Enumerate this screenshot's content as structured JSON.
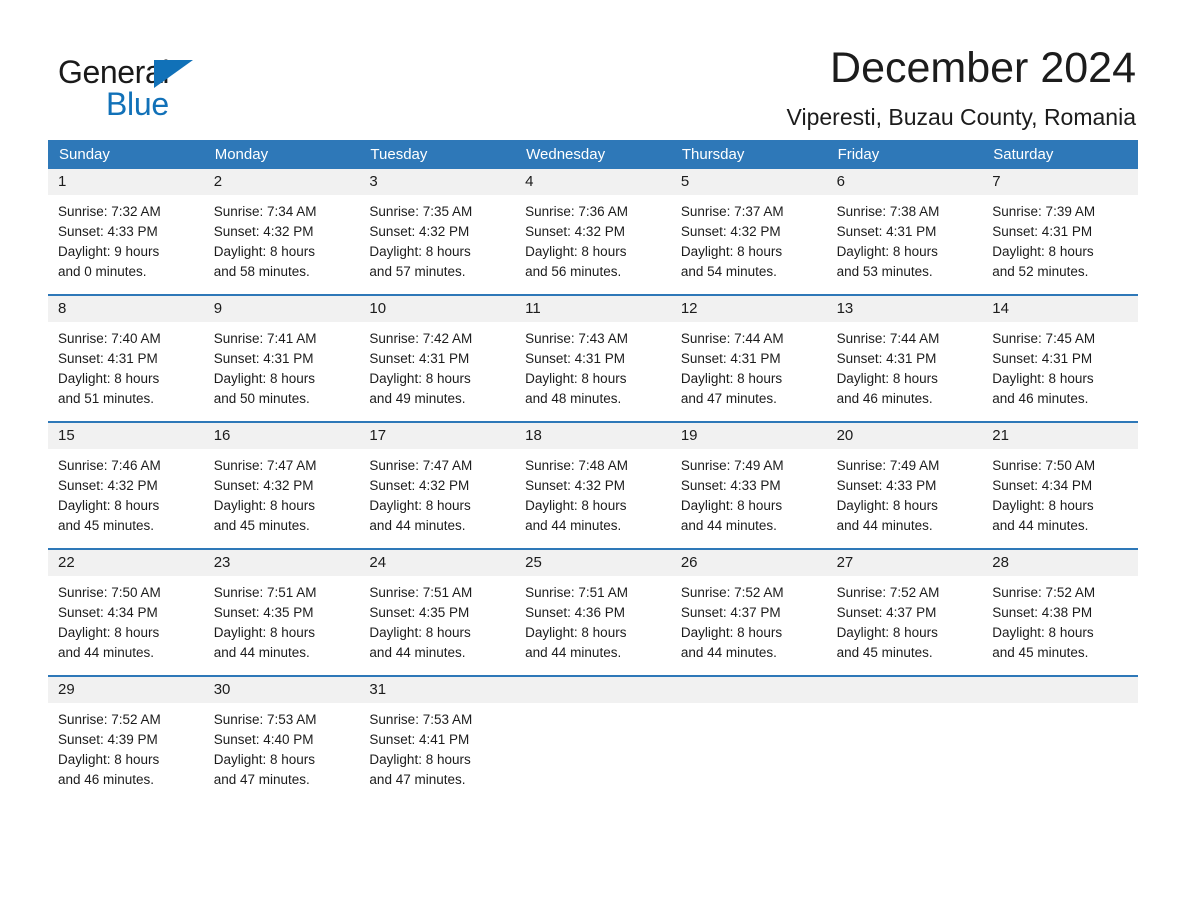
{
  "brand": {
    "name_part1": "General",
    "name_part2": "Blue",
    "accent_color": "#1171b8",
    "triangle_icon": "triangle-icon"
  },
  "header": {
    "month_title": "December 2024",
    "location": "Viperesti, Buzau County, Romania"
  },
  "calendar": {
    "header_bg": "#2e78b8",
    "row_rule_color": "#2e78b8",
    "date_strip_bg": "#f1f1f1",
    "weekdays": [
      "Sunday",
      "Monday",
      "Tuesday",
      "Wednesday",
      "Thursday",
      "Friday",
      "Saturday"
    ],
    "weeks": [
      [
        {
          "date": "1",
          "sunrise": "Sunrise: 7:32 AM",
          "sunset": "Sunset: 4:33 PM",
          "daylight_line1": "Daylight: 9 hours",
          "daylight_line2": "and 0 minutes."
        },
        {
          "date": "2",
          "sunrise": "Sunrise: 7:34 AM",
          "sunset": "Sunset: 4:32 PM",
          "daylight_line1": "Daylight: 8 hours",
          "daylight_line2": "and 58 minutes."
        },
        {
          "date": "3",
          "sunrise": "Sunrise: 7:35 AM",
          "sunset": "Sunset: 4:32 PM",
          "daylight_line1": "Daylight: 8 hours",
          "daylight_line2": "and 57 minutes."
        },
        {
          "date": "4",
          "sunrise": "Sunrise: 7:36 AM",
          "sunset": "Sunset: 4:32 PM",
          "daylight_line1": "Daylight: 8 hours",
          "daylight_line2": "and 56 minutes."
        },
        {
          "date": "5",
          "sunrise": "Sunrise: 7:37 AM",
          "sunset": "Sunset: 4:32 PM",
          "daylight_line1": "Daylight: 8 hours",
          "daylight_line2": "and 54 minutes."
        },
        {
          "date": "6",
          "sunrise": "Sunrise: 7:38 AM",
          "sunset": "Sunset: 4:31 PM",
          "daylight_line1": "Daylight: 8 hours",
          "daylight_line2": "and 53 minutes."
        },
        {
          "date": "7",
          "sunrise": "Sunrise: 7:39 AM",
          "sunset": "Sunset: 4:31 PM",
          "daylight_line1": "Daylight: 8 hours",
          "daylight_line2": "and 52 minutes."
        }
      ],
      [
        {
          "date": "8",
          "sunrise": "Sunrise: 7:40 AM",
          "sunset": "Sunset: 4:31 PM",
          "daylight_line1": "Daylight: 8 hours",
          "daylight_line2": "and 51 minutes."
        },
        {
          "date": "9",
          "sunrise": "Sunrise: 7:41 AM",
          "sunset": "Sunset: 4:31 PM",
          "daylight_line1": "Daylight: 8 hours",
          "daylight_line2": "and 50 minutes."
        },
        {
          "date": "10",
          "sunrise": "Sunrise: 7:42 AM",
          "sunset": "Sunset: 4:31 PM",
          "daylight_line1": "Daylight: 8 hours",
          "daylight_line2": "and 49 minutes."
        },
        {
          "date": "11",
          "sunrise": "Sunrise: 7:43 AM",
          "sunset": "Sunset: 4:31 PM",
          "daylight_line1": "Daylight: 8 hours",
          "daylight_line2": "and 48 minutes."
        },
        {
          "date": "12",
          "sunrise": "Sunrise: 7:44 AM",
          "sunset": "Sunset: 4:31 PM",
          "daylight_line1": "Daylight: 8 hours",
          "daylight_line2": "and 47 minutes."
        },
        {
          "date": "13",
          "sunrise": "Sunrise: 7:44 AM",
          "sunset": "Sunset: 4:31 PM",
          "daylight_line1": "Daylight: 8 hours",
          "daylight_line2": "and 46 minutes."
        },
        {
          "date": "14",
          "sunrise": "Sunrise: 7:45 AM",
          "sunset": "Sunset: 4:31 PM",
          "daylight_line1": "Daylight: 8 hours",
          "daylight_line2": "and 46 minutes."
        }
      ],
      [
        {
          "date": "15",
          "sunrise": "Sunrise: 7:46 AM",
          "sunset": "Sunset: 4:32 PM",
          "daylight_line1": "Daylight: 8 hours",
          "daylight_line2": "and 45 minutes."
        },
        {
          "date": "16",
          "sunrise": "Sunrise: 7:47 AM",
          "sunset": "Sunset: 4:32 PM",
          "daylight_line1": "Daylight: 8 hours",
          "daylight_line2": "and 45 minutes."
        },
        {
          "date": "17",
          "sunrise": "Sunrise: 7:47 AM",
          "sunset": "Sunset: 4:32 PM",
          "daylight_line1": "Daylight: 8 hours",
          "daylight_line2": "and 44 minutes."
        },
        {
          "date": "18",
          "sunrise": "Sunrise: 7:48 AM",
          "sunset": "Sunset: 4:32 PM",
          "daylight_line1": "Daylight: 8 hours",
          "daylight_line2": "and 44 minutes."
        },
        {
          "date": "19",
          "sunrise": "Sunrise: 7:49 AM",
          "sunset": "Sunset: 4:33 PM",
          "daylight_line1": "Daylight: 8 hours",
          "daylight_line2": "and 44 minutes."
        },
        {
          "date": "20",
          "sunrise": "Sunrise: 7:49 AM",
          "sunset": "Sunset: 4:33 PM",
          "daylight_line1": "Daylight: 8 hours",
          "daylight_line2": "and 44 minutes."
        },
        {
          "date": "21",
          "sunrise": "Sunrise: 7:50 AM",
          "sunset": "Sunset: 4:34 PM",
          "daylight_line1": "Daylight: 8 hours",
          "daylight_line2": "and 44 minutes."
        }
      ],
      [
        {
          "date": "22",
          "sunrise": "Sunrise: 7:50 AM",
          "sunset": "Sunset: 4:34 PM",
          "daylight_line1": "Daylight: 8 hours",
          "daylight_line2": "and 44 minutes."
        },
        {
          "date": "23",
          "sunrise": "Sunrise: 7:51 AM",
          "sunset": "Sunset: 4:35 PM",
          "daylight_line1": "Daylight: 8 hours",
          "daylight_line2": "and 44 minutes."
        },
        {
          "date": "24",
          "sunrise": "Sunrise: 7:51 AM",
          "sunset": "Sunset: 4:35 PM",
          "daylight_line1": "Daylight: 8 hours",
          "daylight_line2": "and 44 minutes."
        },
        {
          "date": "25",
          "sunrise": "Sunrise: 7:51 AM",
          "sunset": "Sunset: 4:36 PM",
          "daylight_line1": "Daylight: 8 hours",
          "daylight_line2": "and 44 minutes."
        },
        {
          "date": "26",
          "sunrise": "Sunrise: 7:52 AM",
          "sunset": "Sunset: 4:37 PM",
          "daylight_line1": "Daylight: 8 hours",
          "daylight_line2": "and 44 minutes."
        },
        {
          "date": "27",
          "sunrise": "Sunrise: 7:52 AM",
          "sunset": "Sunset: 4:37 PM",
          "daylight_line1": "Daylight: 8 hours",
          "daylight_line2": "and 45 minutes."
        },
        {
          "date": "28",
          "sunrise": "Sunrise: 7:52 AM",
          "sunset": "Sunset: 4:38 PM",
          "daylight_line1": "Daylight: 8 hours",
          "daylight_line2": "and 45 minutes."
        }
      ],
      [
        {
          "date": "29",
          "sunrise": "Sunrise: 7:52 AM",
          "sunset": "Sunset: 4:39 PM",
          "daylight_line1": "Daylight: 8 hours",
          "daylight_line2": "and 46 minutes."
        },
        {
          "date": "30",
          "sunrise": "Sunrise: 7:53 AM",
          "sunset": "Sunset: 4:40 PM",
          "daylight_line1": "Daylight: 8 hours",
          "daylight_line2": "and 47 minutes."
        },
        {
          "date": "31",
          "sunrise": "Sunrise: 7:53 AM",
          "sunset": "Sunset: 4:41 PM",
          "daylight_line1": "Daylight: 8 hours",
          "daylight_line2": "and 47 minutes."
        },
        {
          "date": "",
          "sunrise": "",
          "sunset": "",
          "daylight_line1": "",
          "daylight_line2": ""
        },
        {
          "date": "",
          "sunrise": "",
          "sunset": "",
          "daylight_line1": "",
          "daylight_line2": ""
        },
        {
          "date": "",
          "sunrise": "",
          "sunset": "",
          "daylight_line1": "",
          "daylight_line2": ""
        },
        {
          "date": "",
          "sunrise": "",
          "sunset": "",
          "daylight_line1": "",
          "daylight_line2": ""
        }
      ]
    ]
  }
}
